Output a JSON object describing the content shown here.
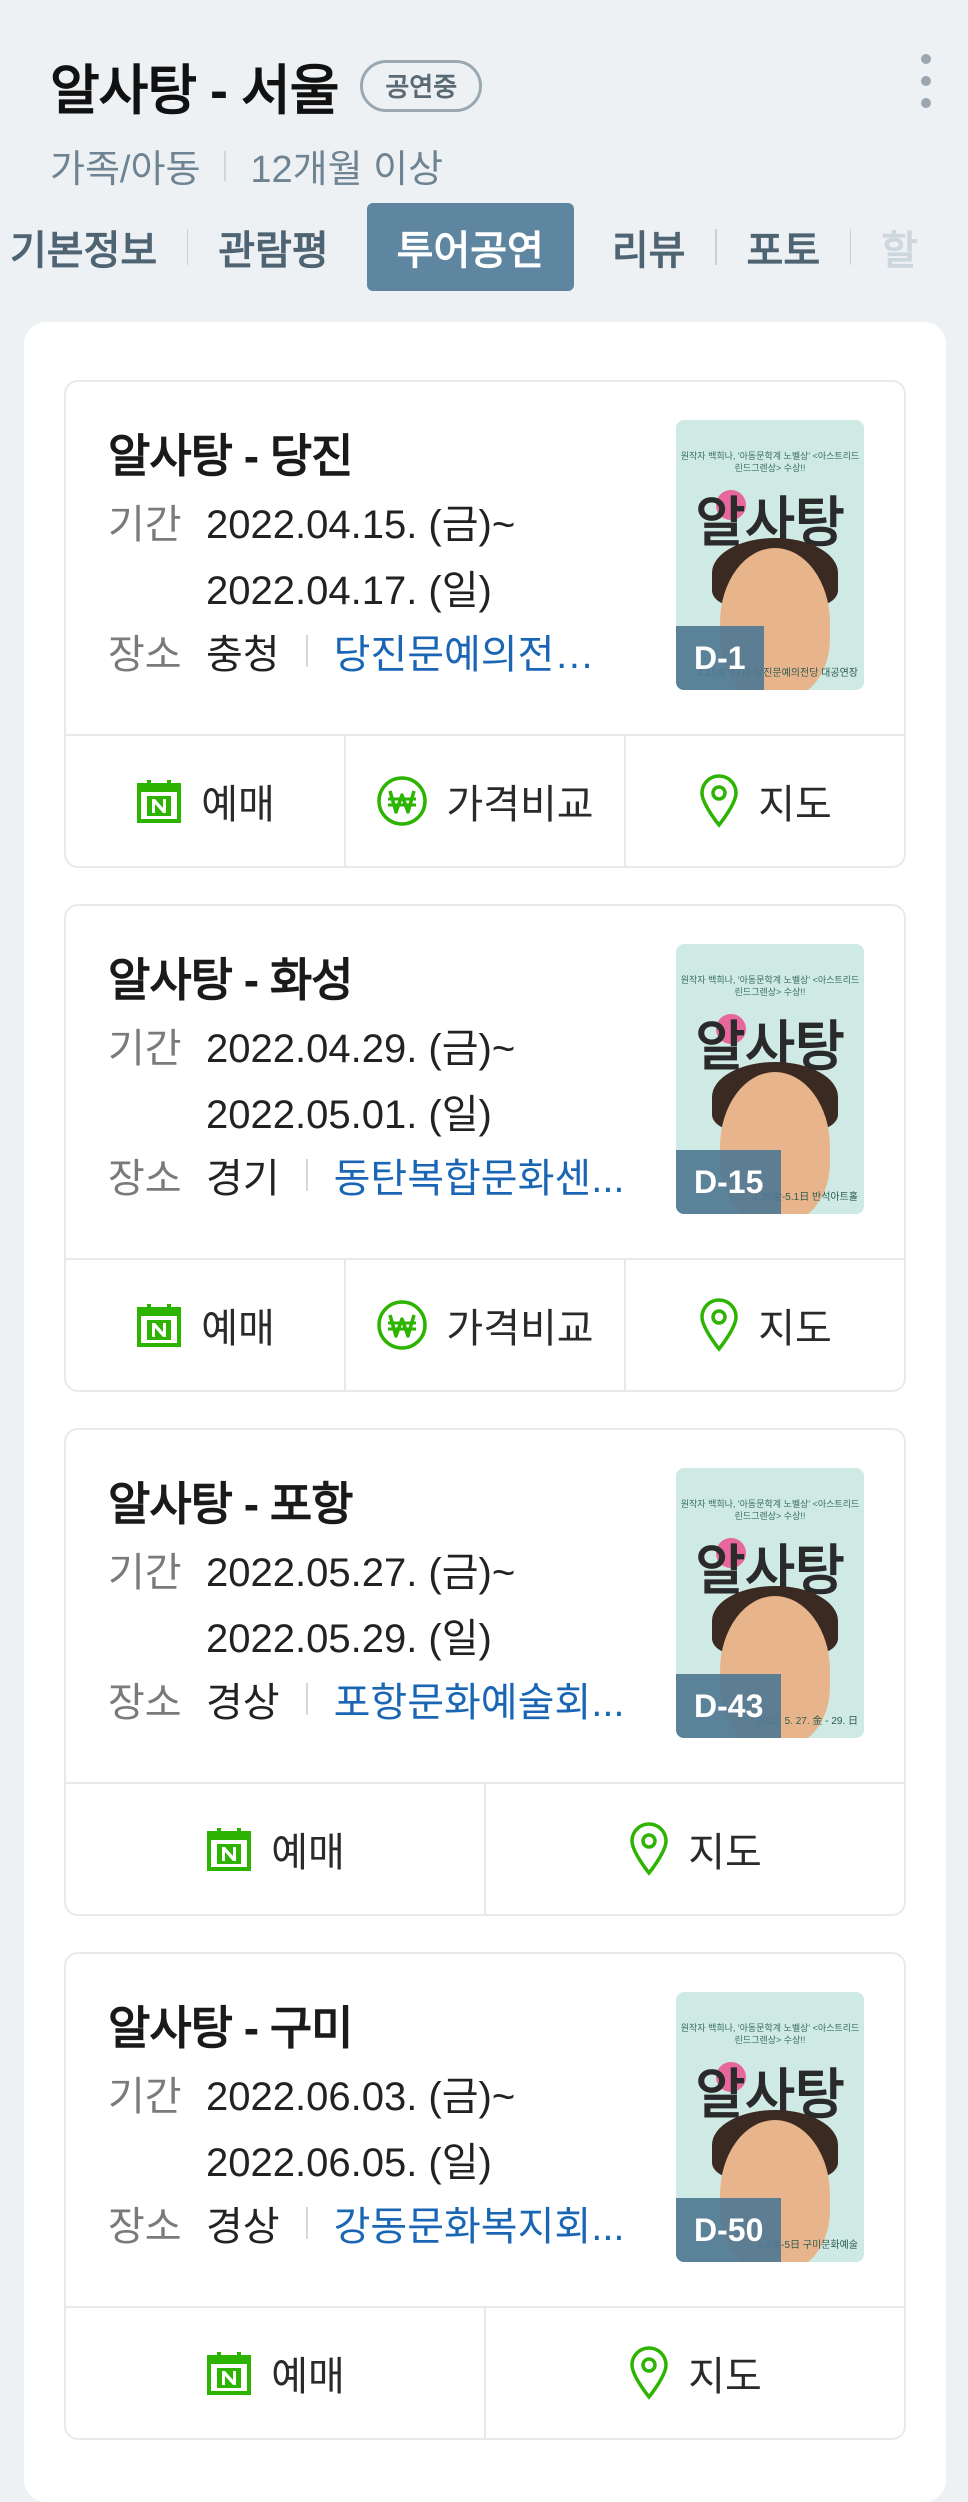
{
  "header": {
    "title": "알사탕 - 서울",
    "badge": "공연중",
    "genre": "가족/아동",
    "age": "12개월 이상"
  },
  "tabs": [
    {
      "label": "기본정보"
    },
    {
      "label": "관람평"
    },
    {
      "label": "투어공연",
      "active": true
    },
    {
      "label": "리뷰"
    },
    {
      "label": "포토"
    },
    {
      "label": "할"
    }
  ],
  "labels": {
    "period": "기간",
    "place": "장소",
    "book": "예매",
    "price_compare": "가격비교",
    "map": "지도"
  },
  "poster": {
    "tagline": "원작자 백희나, '아동문학계 노벨상' <아스트리드 린드그렌상> 수상!!",
    "name": "알사탕"
  },
  "tours": [
    {
      "title": "알사탕 - 당진",
      "start": "2022.04.15. (금)~",
      "end": "2022.04.17. (일)",
      "region": "충청",
      "venue": "당진문예의전당 ...",
      "dday": "D-1",
      "poster_date": "4.15金-17日 당진문예의전당 대공연장",
      "actions": [
        "book",
        "price_compare",
        "map"
      ]
    },
    {
      "title": "알사탕 - 화성",
      "start": "2022.04.29. (금)~",
      "end": "2022.05.01. (일)",
      "region": "경기",
      "venue": "동탄복합문화센...",
      "dday": "D-15",
      "poster_date": "4.29金-5.1日 반석아트홀",
      "actions": [
        "book",
        "price_compare",
        "map"
      ]
    },
    {
      "title": "알사탕 - 포항",
      "start": "2022.05.27. (금)~",
      "end": "2022.05.29. (일)",
      "region": "경상",
      "venue": "포항문화예술회...",
      "dday": "D-43",
      "poster_date": "2022. 5. 27. 金 - 29. 日",
      "actions": [
        "book",
        "map"
      ]
    },
    {
      "title": "알사탕 - 구미",
      "start": "2022.06.03. (금)~",
      "end": "2022.06.05. (일)",
      "region": "경상",
      "venue": "강동문화복지회...",
      "dday": "D-50",
      "poster_date": "6.3金-5日 구미문화예술",
      "actions": [
        "book",
        "map"
      ]
    }
  ],
  "colors": {
    "accent": "#5f86a1",
    "naver_green": "#2db400",
    "venue_link": "#1a66b5"
  }
}
